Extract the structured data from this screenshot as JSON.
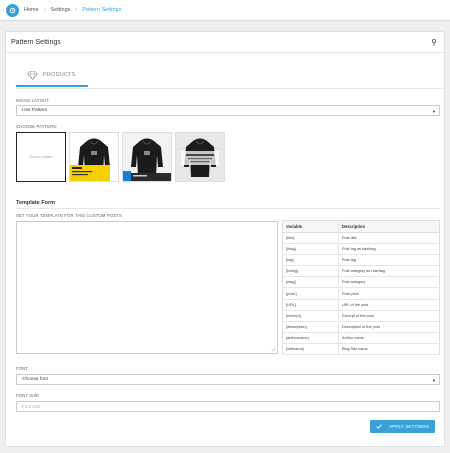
{
  "breadcrumb": {
    "items": [
      "Home",
      "Settings",
      "Pattern Settings"
    ],
    "separator": "›"
  },
  "card": {
    "title": "Pattern Settings"
  },
  "tab": {
    "label": "PRODUCTS",
    "icon": "diamond-icon"
  },
  "image_layout": {
    "label": "IMAGE LAYOUT",
    "value": "Use Pattern"
  },
  "patterns": {
    "label": "CHOOSE PATTERN",
    "none_text": "Choose a pattern",
    "selected_index": 0
  },
  "template_form": {
    "title": "Template Form",
    "textarea_label": "SET YOUR TEMPLATE FOR THIS CUSTOM POSTS",
    "columns": [
      "Variable",
      "Description"
    ],
    "rows": [
      [
        "{title}",
        "Post title"
      ],
      [
        "{htag}",
        "Post tag as hashtag"
      ],
      [
        "{tag}",
        "Post tag"
      ],
      [
        "{hctag}",
        "Post category as hashtag"
      ],
      [
        "{ctag}",
        "Post category"
      ],
      [
        "{price}",
        "Post price"
      ],
      [
        "{URL}",
        "URL of the post"
      ],
      [
        "{excerpt}",
        "Excerpt of the post"
      ],
      [
        "{description}",
        "Description of the post"
      ],
      [
        "{authorname}",
        "Author name"
      ],
      [
        "{sitename}",
        "Blog Site name"
      ]
    ]
  },
  "font": {
    "label": "FONT",
    "value": "Choose font"
  },
  "font_size": {
    "label": "FONT SIZE",
    "placeholder": "Font size"
  },
  "apply_button": {
    "label": "APPLY SETTINGS"
  },
  "colors": {
    "accent": "#3aa0d8",
    "pattern_yellow": "#f4d000",
    "pattern_blue": "#1a7fd4"
  }
}
